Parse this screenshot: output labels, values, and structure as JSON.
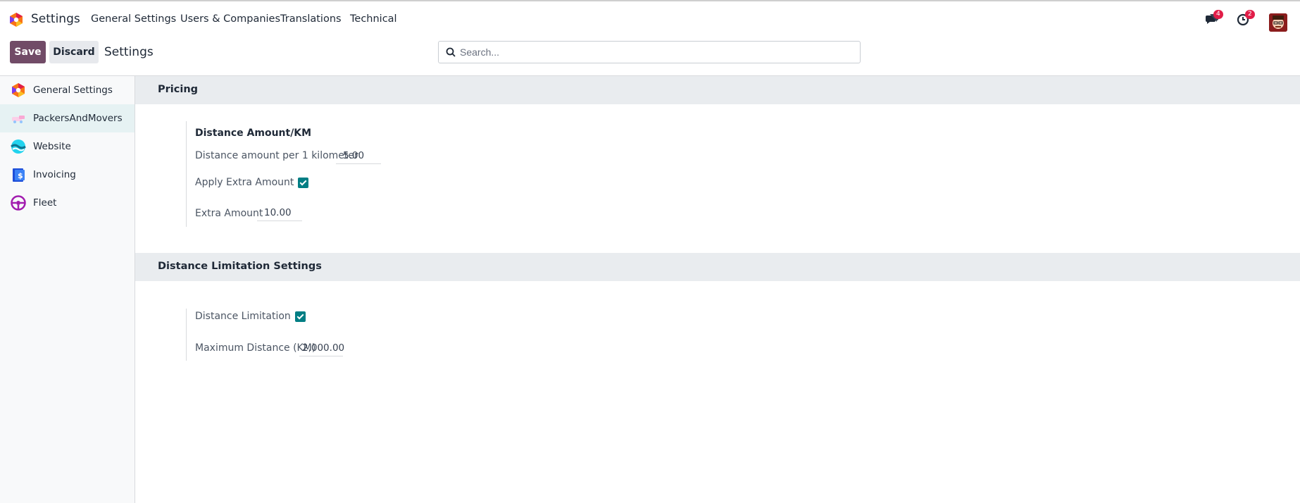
{
  "navbar": {
    "app_name": "Settings",
    "menu": [
      "General Settings",
      "Users & Companies",
      "Translations",
      "Technical"
    ],
    "messages_count": "4",
    "activities_count": "2"
  },
  "controlbar": {
    "save_label": "Save",
    "discard_label": "Discard",
    "breadcrumb": "Settings",
    "search_placeholder": "Search..."
  },
  "sidebar": {
    "items": [
      {
        "label": "General Settings",
        "icon": "odoo-logo-icon"
      },
      {
        "label": "PackersAndMovers",
        "icon": "packers-movers-icon"
      },
      {
        "label": "Website",
        "icon": "website-icon"
      },
      {
        "label": "Invoicing",
        "icon": "invoicing-icon"
      },
      {
        "label": "Fleet",
        "icon": "fleet-icon"
      }
    ]
  },
  "sections": {
    "pricing": {
      "title": "Pricing",
      "block_title": "Distance Amount/KM",
      "distance_amount_label": "Distance amount per 1 kilometer",
      "distance_amount_value": "5.00",
      "apply_extra_label": "Apply Extra Amount",
      "apply_extra_checked": true,
      "extra_amount_label": "Extra Amount",
      "extra_amount_value": "10.00"
    },
    "distance_limitation": {
      "title": "Distance Limitation Settings",
      "limitation_label": "Distance Limitation",
      "limitation_checked": true,
      "max_distance_label": "Maximum Distance (KM)",
      "max_distance_value": "2,000.00"
    }
  },
  "colors": {
    "brand": "#714b67",
    "checkbox": "#017e84",
    "badge": "#e11d48"
  }
}
